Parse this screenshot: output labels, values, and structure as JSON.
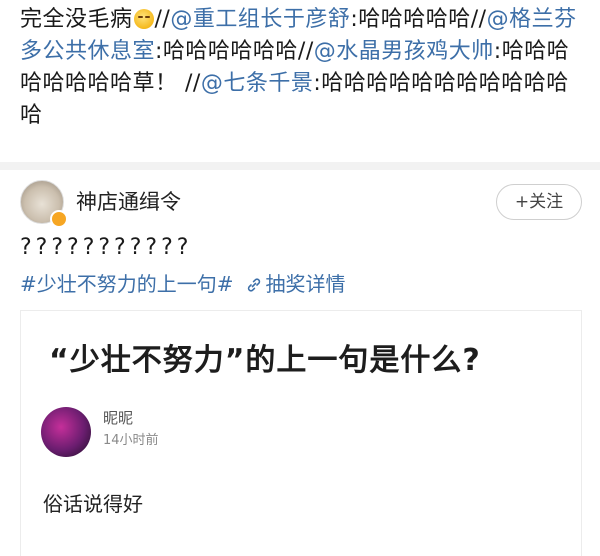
{
  "repost": {
    "prefix": "完全没毛病",
    "emoji": "grinning-sweat-emoji",
    "sep1": "//",
    "mention1": "@重工组长于彦舒",
    "text1": ":哈哈哈哈哈//",
    "mention2": "@格兰芬多公共休息室",
    "text2": ":哈哈哈哈哈哈//",
    "mention3": "@水晶男孩鸡大帅",
    "text3": ":哈哈哈哈哈哈哈哈草！ //",
    "mention4": "@七条千景",
    "text4": ":哈哈哈哈哈哈哈哈哈哈哈哈"
  },
  "post": {
    "username": "神店通缉令",
    "follow_label": "+关注",
    "text": "???????????",
    "hashtag": "#少壮不努力的上一句#",
    "lottery_label": "抽奖详情"
  },
  "card": {
    "title": "“少壮不努力”的上一句是什么?",
    "user": "昵昵",
    "time": "14小时前",
    "body": "俗话说得好"
  },
  "colors": {
    "link": "#3d6fa8",
    "divider": "#f2f2f2",
    "verified_badge": "#f6a623"
  }
}
